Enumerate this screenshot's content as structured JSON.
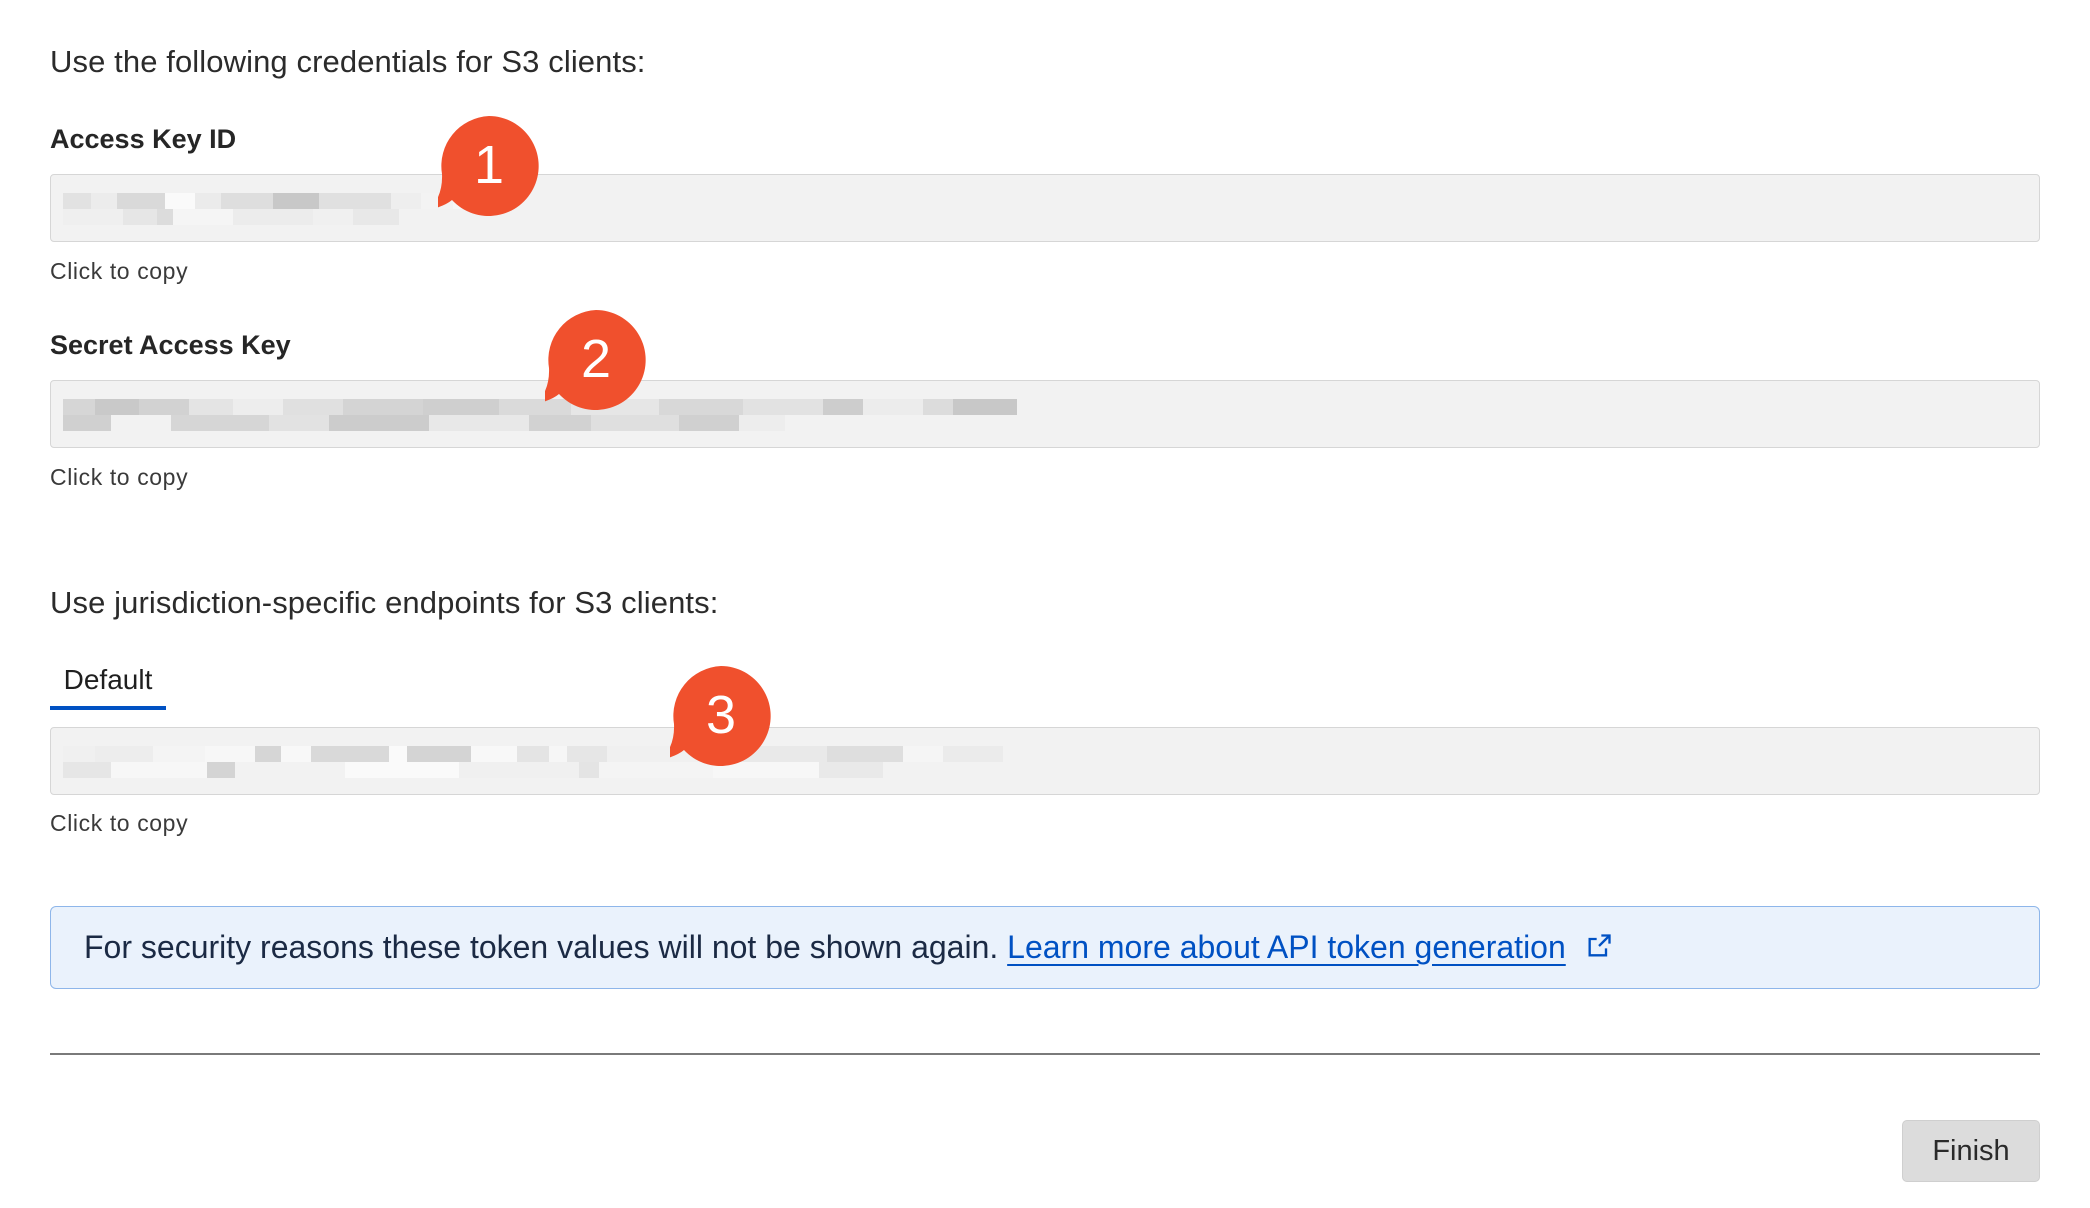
{
  "credentials": {
    "heading": "Use the following credentials for S3 clients:",
    "access_key": {
      "label": "Access Key ID",
      "hint": "Click to copy",
      "badge": "1"
    },
    "secret_key": {
      "label": "Secret Access Key",
      "hint": "Click to copy",
      "badge": "2"
    }
  },
  "endpoints": {
    "heading": "Use jurisdiction-specific endpoints for S3 clients:",
    "tabs": [
      {
        "label": "Default",
        "active": true
      }
    ],
    "hint": "Click to copy",
    "badge": "3"
  },
  "notice": {
    "message": "For security reasons these token values will not be shown again.",
    "link_text": "Learn more about API token generation",
    "icon": "external-link-icon"
  },
  "footer": {
    "finish_label": "Finish"
  },
  "colors": {
    "badge": "#f0502d",
    "accent": "#0051c3",
    "notice_bg": "#eaf2fc"
  }
}
